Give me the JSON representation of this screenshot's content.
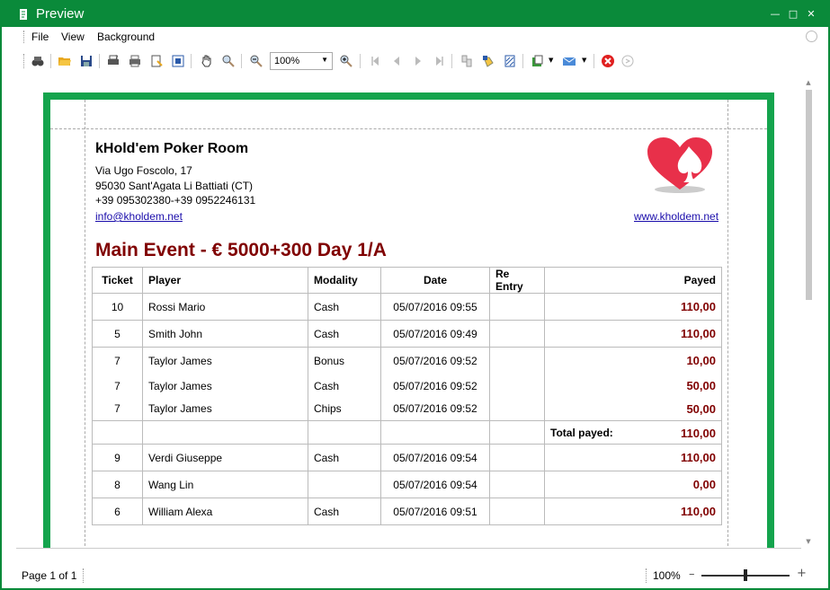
{
  "window": {
    "title": "Preview"
  },
  "menu": {
    "items": [
      "File",
      "View",
      "Background"
    ]
  },
  "toolbar": {
    "zoom_value": "100%"
  },
  "report": {
    "company": "kHold'em Poker Room",
    "address_line1": "Via Ugo Foscolo, 17",
    "address_line2": "95030 Sant'Agata Li Battiati (CT)",
    "phone": "+39 095302380-+39 0952246131",
    "email": "info@kholdem.net",
    "website": "www.kholdem.net",
    "event_title": "Main Event - € 5000+300 Day 1/A",
    "columns": [
      "Ticket",
      "Player",
      "Modality",
      "Date",
      "Re Entry",
      "Payed"
    ],
    "rows": [
      {
        "ticket": "10",
        "player": "Rossi Mario",
        "modality": "Cash",
        "date": "05/07/2016 09:55",
        "reentry": "",
        "payed": "110,00"
      },
      {
        "ticket": "5",
        "player": "Smith John",
        "modality": "Cash",
        "date": "05/07/2016 09:49",
        "reentry": "",
        "payed": "110,00"
      },
      {
        "ticket": "7",
        "player": "Taylor James",
        "modality": "Bonus",
        "date": "05/07/2016 09:52",
        "reentry": "",
        "payed": "10,00"
      },
      {
        "ticket": "7",
        "player": "Taylor James",
        "modality": "Cash",
        "date": "05/07/2016 09:52",
        "reentry": "",
        "payed": "50,00"
      },
      {
        "ticket": "7",
        "player": "Taylor James",
        "modality": "Chips",
        "date": "05/07/2016 09:52",
        "reentry": "",
        "payed": "50,00"
      },
      {
        "ticket": "9",
        "player": "Verdi Giuseppe",
        "modality": "Cash",
        "date": "05/07/2016 09:54",
        "reentry": "",
        "payed": "110,00"
      },
      {
        "ticket": "8",
        "player": "Wang Lin",
        "modality": "",
        "date": "05/07/2016 09:54",
        "reentry": "",
        "payed": "0,00"
      },
      {
        "ticket": "6",
        "player": "William Alexa",
        "modality": "Cash",
        "date": "05/07/2016 09:51",
        "reentry": "",
        "payed": "110,00"
      }
    ],
    "total_label": "Total payed:",
    "total_value": "110,00"
  },
  "status": {
    "page": "Page 1 of 1",
    "zoom": "100%"
  },
  "colors": {
    "frame": "#0a8a3a",
    "page_border": "#14a44d",
    "accent": "#800000",
    "logo": "#e8304a"
  }
}
